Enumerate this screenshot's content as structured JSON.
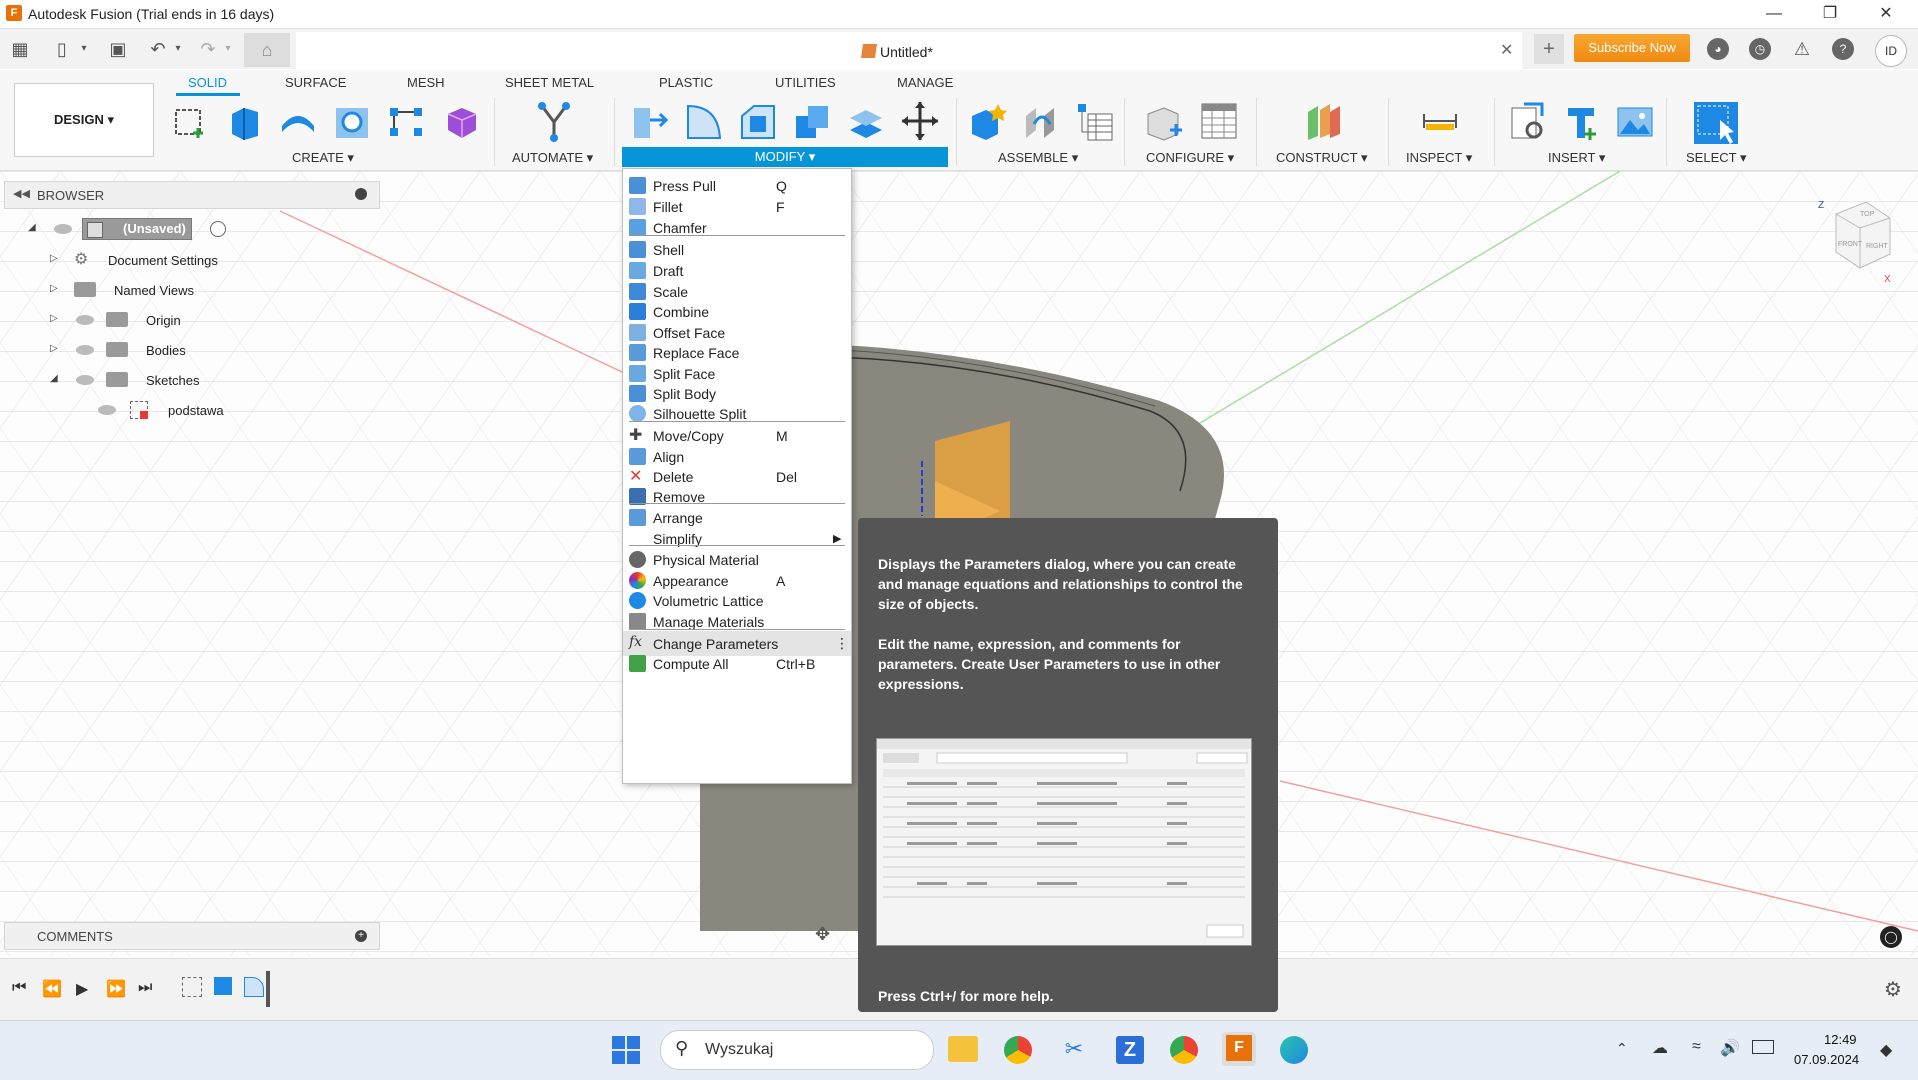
{
  "window": {
    "title": "Autodesk Fusion (Trial ends in 16 days)",
    "app_logo": "F"
  },
  "document": {
    "title": "Untitled*"
  },
  "header": {
    "subscribe_label": "Subscribe Now",
    "avatar_initials": "ID"
  },
  "workspace": {
    "label": "DESIGN ▾"
  },
  "ribbon": {
    "tabs": [
      "SOLID",
      "SURFACE",
      "MESH",
      "SHEET METAL",
      "PLASTIC",
      "UTILITIES",
      "MANAGE"
    ],
    "active_tab": "SOLID",
    "groups": {
      "create": "CREATE ▾",
      "automate": "AUTOMATE ▾",
      "modify": "MODIFY ▾",
      "assemble": "ASSEMBLE ▾",
      "configure": "CONFIGURE ▾",
      "construct": "CONSTRUCT ▾",
      "inspect": "INSPECT ▾",
      "insert": "INSERT ▾",
      "select": "SELECT ▾"
    }
  },
  "browser": {
    "title": "BROWSER",
    "root": "(Unsaved)",
    "items": [
      "Document Settings",
      "Named Views",
      "Origin",
      "Bodies",
      "Sketches"
    ],
    "sketch": "podstawa"
  },
  "comments": {
    "title": "COMMENTS"
  },
  "modify_menu": {
    "items": [
      {
        "label": "Press Pull",
        "shortcut": "Q",
        "icon": "press-pull-icon",
        "color": "#4a90d9"
      },
      {
        "label": "Fillet",
        "shortcut": "F",
        "icon": "fillet-icon",
        "color": "#8fb8e8"
      },
      {
        "label": "Chamfer",
        "shortcut": "",
        "icon": "chamfer-icon",
        "color": "#5aa0e0"
      },
      {
        "label": "Shell",
        "shortcut": "",
        "icon": "shell-icon",
        "color": "#4a90d9"
      },
      {
        "label": "Draft",
        "shortcut": "",
        "icon": "draft-icon",
        "color": "#6aa8e0"
      },
      {
        "label": "Scale",
        "shortcut": "",
        "icon": "scale-icon",
        "color": "#3c8ad8"
      },
      {
        "label": "Combine",
        "shortcut": "",
        "icon": "combine-icon",
        "color": "#2b7fd6"
      },
      {
        "label": "Offset Face",
        "shortcut": "",
        "icon": "offset-face-icon",
        "color": "#7fb0e0"
      },
      {
        "label": "Replace Face",
        "shortcut": "",
        "icon": "replace-face-icon",
        "color": "#5a9ad8"
      },
      {
        "label": "Split Face",
        "shortcut": "",
        "icon": "split-face-icon",
        "color": "#6aa8e0"
      },
      {
        "label": "Split Body",
        "shortcut": "",
        "icon": "split-body-icon",
        "color": "#4a90d9"
      },
      {
        "label": "Silhouette Split",
        "shortcut": "",
        "icon": "silhouette-split-icon",
        "color": "#7fb4e8"
      },
      {
        "label": "Move/Copy",
        "shortcut": "M",
        "icon": "move-icon",
        "color": "#444444"
      },
      {
        "label": "Align",
        "shortcut": "",
        "icon": "align-icon",
        "color": "#5a9ad8"
      },
      {
        "label": "Delete",
        "shortcut": "Del",
        "icon": "delete-icon",
        "color": "#e53935"
      },
      {
        "label": "Remove",
        "shortcut": "",
        "icon": "remove-icon",
        "color": "#3a6fb0"
      },
      {
        "label": "Arrange",
        "shortcut": "",
        "icon": "arrange-icon",
        "color": "#5a9ad8"
      },
      {
        "label": "Simplify",
        "shortcut": "",
        "icon": "",
        "color": ""
      },
      {
        "label": "Physical Material",
        "shortcut": "",
        "icon": "physical-material-icon",
        "color": "#666666"
      },
      {
        "label": "Appearance",
        "shortcut": "A",
        "icon": "appearance-icon",
        "color": "#e0a030"
      },
      {
        "label": "Volumetric Lattice",
        "shortcut": "",
        "icon": "volumetric-lattice-icon",
        "color": "#1e88e5"
      },
      {
        "label": "Manage Materials",
        "shortcut": "",
        "icon": "manage-materials-icon",
        "color": "#888888"
      },
      {
        "label": "Change Parameters",
        "shortcut": "",
        "icon": "fx-icon",
        "color": ""
      },
      {
        "label": "Compute All",
        "shortcut": "Ctrl+B",
        "icon": "compute-all-icon",
        "color": "#43a047"
      }
    ]
  },
  "tooltip": {
    "paragraph1": "Displays the Parameters dialog, where you can create and manage equations and relationships to control the size of objects.",
    "paragraph2": "Edit the name, expression, and comments for parameters. Create User Parameters to use in other expressions.",
    "footer": "Press Ctrl+/ for more help."
  },
  "taskbar": {
    "search_placeholder": "Wyszukaj",
    "time": "12:49",
    "date": "07.09.2024"
  },
  "colors": {
    "accent": "#0696d7",
    "subscribe": "#f5a623"
  }
}
